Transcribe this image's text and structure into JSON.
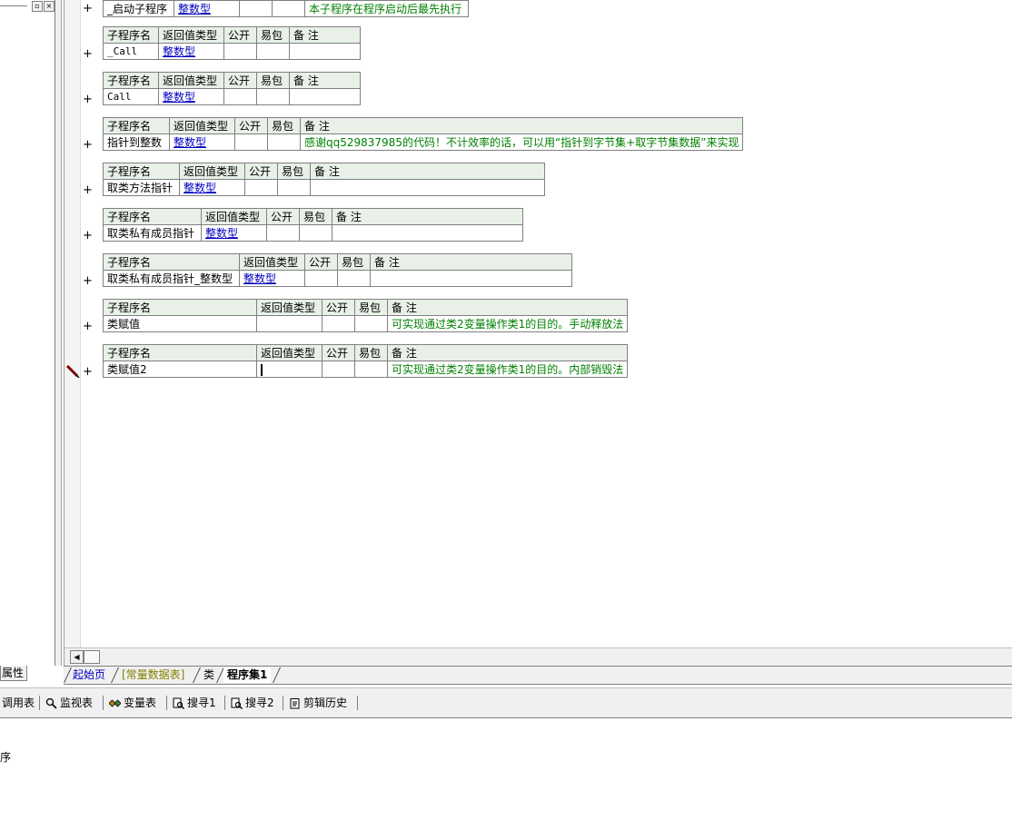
{
  "left_panel": {
    "pin_symbol": "▫",
    "close_symbol": "×",
    "tab_label": "属性"
  },
  "table_headers": {
    "name": "子程序名",
    "return_type": "返回值类型",
    "public": "公开",
    "easy": "易包",
    "remark": "备 注"
  },
  "first_row": {
    "plus": "+",
    "name": "_启动子程序",
    "type": "整数型",
    "remark": "本子程序在程序启动后最先执行"
  },
  "subs": [
    {
      "plus": "+",
      "name": "_Call",
      "type": "整数型",
      "remark": ""
    },
    {
      "plus": "+",
      "name": "Call",
      "type": "整数型",
      "remark": ""
    },
    {
      "plus": "+",
      "name": "指针到整数",
      "type": "整数型",
      "remark": "感谢qq529837985的代码！不计效率的话，可以用“指针到字节集+取字节集数据”来实现"
    },
    {
      "plus": "+",
      "name": "取类方法指针",
      "type": "整数型",
      "remark": ""
    },
    {
      "plus": "+",
      "name": "取类私有成员指针",
      "type": "整数型",
      "remark": ""
    },
    {
      "plus": "+",
      "name": "取类私有成员指针_整数型",
      "type": "整数型",
      "remark": ""
    },
    {
      "plus": "+",
      "name": "类赋值",
      "type": "",
      "remark": "可实现通过类2变量操作类1的目的。手动释放法"
    },
    {
      "plus": "+",
      "name": "类赋值2",
      "type": "",
      "remark": "可实现通过类2变量操作类1的目的。内部销毁法"
    }
  ],
  "tabs": [
    "起始页",
    "[常量数据表]",
    "类",
    "程序集1"
  ],
  "toolbar": [
    "调用表",
    "监视表",
    "变量表",
    "搜寻1",
    "搜寻2",
    "剪辑历史"
  ],
  "output_text": "序",
  "colors": {
    "header_bg": "#e8f0e8",
    "type_link": "#0000c0",
    "remark": "#008000"
  }
}
